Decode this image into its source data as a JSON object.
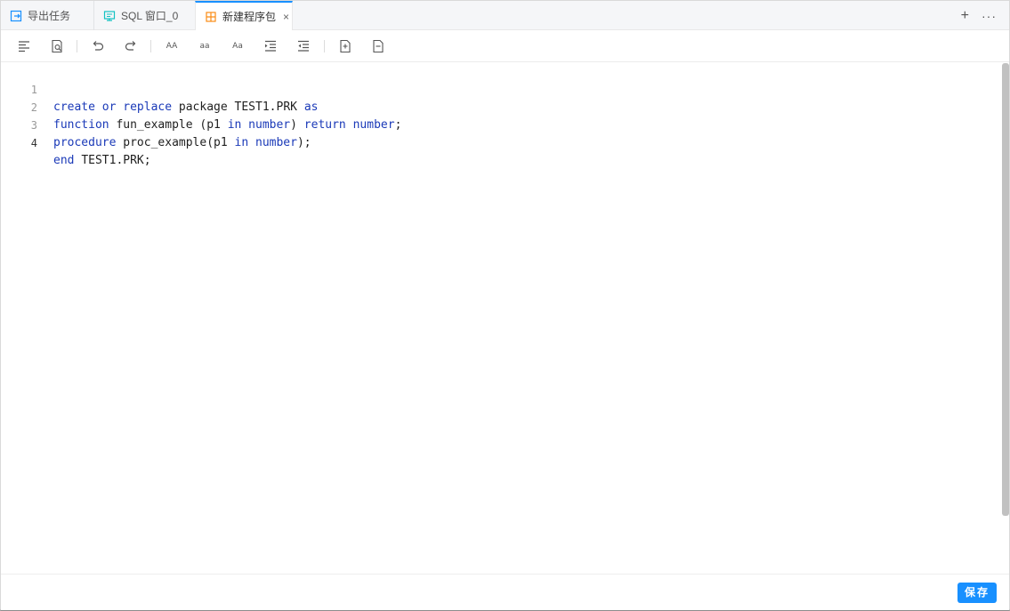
{
  "tabs": [
    {
      "label": "导出任务",
      "icon": "export-icon",
      "color": "#1890ff"
    },
    {
      "label": "SQL 窗口_0",
      "icon": "sql-window-icon",
      "color": "#13c2c2"
    },
    {
      "label": "新建程序包",
      "icon": "package-icon",
      "color": "#fa8c16",
      "active": true,
      "close": "×"
    }
  ],
  "tab_actions": {
    "add": "+",
    "more": "···"
  },
  "toolbar": {
    "buttons": [
      {
        "name": "format-icon"
      },
      {
        "name": "find-icon"
      },
      {
        "name": "undo-icon"
      },
      {
        "name": "redo-icon"
      },
      {
        "name": "uppercase-icon",
        "text": "AA"
      },
      {
        "name": "lowercase-icon",
        "text": "aa"
      },
      {
        "name": "capitalize-icon",
        "text": "Aa"
      },
      {
        "name": "indent-icon"
      },
      {
        "name": "outdent-icon"
      },
      {
        "name": "comment-icon"
      },
      {
        "name": "uncomment-icon"
      }
    ]
  },
  "editor": {
    "lines": [
      {
        "num": "1",
        "code": "create or replace package TEST1.PRK as"
      },
      {
        "num": "2",
        "code": "function fun_example (p1 in number) return number;"
      },
      {
        "num": "3",
        "code": "procedure proc_example(p1 in number);"
      },
      {
        "num": "4",
        "code": "end TEST1.PRK;"
      }
    ],
    "active_line": 4,
    "keyword_color": "#1b3ab8"
  },
  "footer": {
    "save_label": "保存"
  }
}
